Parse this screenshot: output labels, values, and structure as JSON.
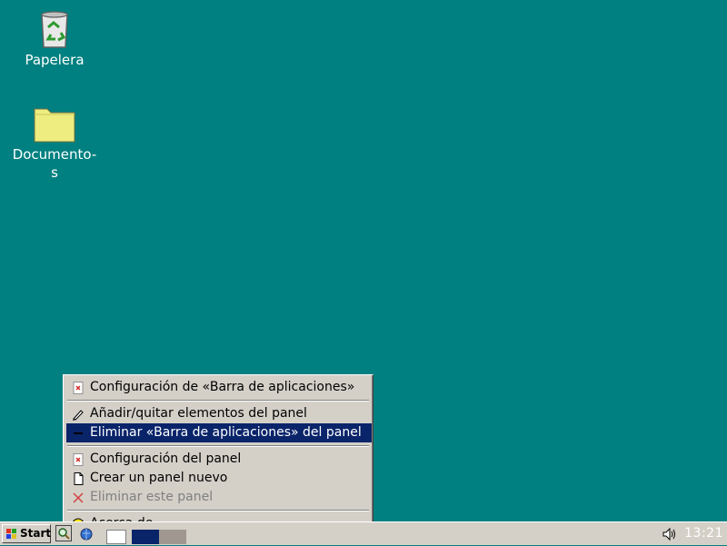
{
  "desktop": {
    "icons": [
      {
        "label": "Papelera"
      },
      {
        "label": "Documento-\ns"
      }
    ]
  },
  "context_menu": {
    "items": [
      {
        "label": "Configuración de «Barra de aplicaciones»",
        "icon": "settings-doc-icon",
        "state": "normal"
      },
      {
        "label": "Añadir/quitar elementos del panel",
        "icon": "pencil-icon",
        "state": "normal"
      },
      {
        "label": "Eliminar «Barra de aplicaciones» del panel",
        "icon": "minus-icon",
        "state": "highlighted"
      },
      {
        "label": "Configuración del panel",
        "icon": "settings-doc-icon",
        "state": "normal"
      },
      {
        "label": "Crear un panel nuevo",
        "icon": "new-document-icon",
        "state": "normal"
      },
      {
        "label": "Eliminar este panel",
        "icon": "red-x-icon",
        "state": "disabled"
      },
      {
        "label": "Acerca de",
        "icon": "smiley-icon",
        "state": "normal"
      }
    ]
  },
  "taskbar": {
    "start_label": "Start",
    "clock": "13:21"
  },
  "colors": {
    "desktop": "#008080",
    "panel": "#d4d0c8",
    "highlight": "#0a246a"
  }
}
